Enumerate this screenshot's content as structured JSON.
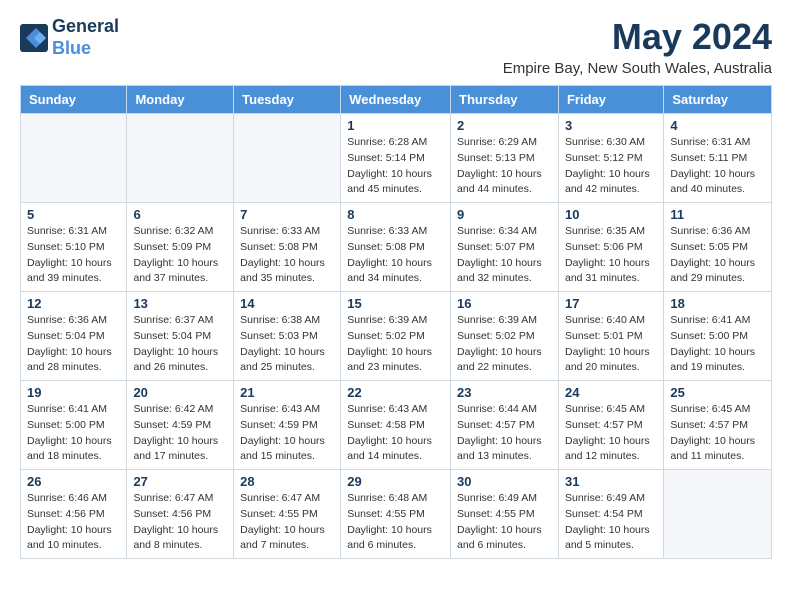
{
  "header": {
    "logo_line1": "General",
    "logo_line2": "Blue",
    "month_title": "May 2024",
    "location": "Empire Bay, New South Wales, Australia"
  },
  "weekdays": [
    "Sunday",
    "Monday",
    "Tuesday",
    "Wednesday",
    "Thursday",
    "Friday",
    "Saturday"
  ],
  "weeks": [
    [
      {
        "day": "",
        "info": ""
      },
      {
        "day": "",
        "info": ""
      },
      {
        "day": "",
        "info": ""
      },
      {
        "day": "1",
        "info": "Sunrise: 6:28 AM\nSunset: 5:14 PM\nDaylight: 10 hours\nand 45 minutes."
      },
      {
        "day": "2",
        "info": "Sunrise: 6:29 AM\nSunset: 5:13 PM\nDaylight: 10 hours\nand 44 minutes."
      },
      {
        "day": "3",
        "info": "Sunrise: 6:30 AM\nSunset: 5:12 PM\nDaylight: 10 hours\nand 42 minutes."
      },
      {
        "day": "4",
        "info": "Sunrise: 6:31 AM\nSunset: 5:11 PM\nDaylight: 10 hours\nand 40 minutes."
      }
    ],
    [
      {
        "day": "5",
        "info": "Sunrise: 6:31 AM\nSunset: 5:10 PM\nDaylight: 10 hours\nand 39 minutes."
      },
      {
        "day": "6",
        "info": "Sunrise: 6:32 AM\nSunset: 5:09 PM\nDaylight: 10 hours\nand 37 minutes."
      },
      {
        "day": "7",
        "info": "Sunrise: 6:33 AM\nSunset: 5:08 PM\nDaylight: 10 hours\nand 35 minutes."
      },
      {
        "day": "8",
        "info": "Sunrise: 6:33 AM\nSunset: 5:08 PM\nDaylight: 10 hours\nand 34 minutes."
      },
      {
        "day": "9",
        "info": "Sunrise: 6:34 AM\nSunset: 5:07 PM\nDaylight: 10 hours\nand 32 minutes."
      },
      {
        "day": "10",
        "info": "Sunrise: 6:35 AM\nSunset: 5:06 PM\nDaylight: 10 hours\nand 31 minutes."
      },
      {
        "day": "11",
        "info": "Sunrise: 6:36 AM\nSunset: 5:05 PM\nDaylight: 10 hours\nand 29 minutes."
      }
    ],
    [
      {
        "day": "12",
        "info": "Sunrise: 6:36 AM\nSunset: 5:04 PM\nDaylight: 10 hours\nand 28 minutes."
      },
      {
        "day": "13",
        "info": "Sunrise: 6:37 AM\nSunset: 5:04 PM\nDaylight: 10 hours\nand 26 minutes."
      },
      {
        "day": "14",
        "info": "Sunrise: 6:38 AM\nSunset: 5:03 PM\nDaylight: 10 hours\nand 25 minutes."
      },
      {
        "day": "15",
        "info": "Sunrise: 6:39 AM\nSunset: 5:02 PM\nDaylight: 10 hours\nand 23 minutes."
      },
      {
        "day": "16",
        "info": "Sunrise: 6:39 AM\nSunset: 5:02 PM\nDaylight: 10 hours\nand 22 minutes."
      },
      {
        "day": "17",
        "info": "Sunrise: 6:40 AM\nSunset: 5:01 PM\nDaylight: 10 hours\nand 20 minutes."
      },
      {
        "day": "18",
        "info": "Sunrise: 6:41 AM\nSunset: 5:00 PM\nDaylight: 10 hours\nand 19 minutes."
      }
    ],
    [
      {
        "day": "19",
        "info": "Sunrise: 6:41 AM\nSunset: 5:00 PM\nDaylight: 10 hours\nand 18 minutes."
      },
      {
        "day": "20",
        "info": "Sunrise: 6:42 AM\nSunset: 4:59 PM\nDaylight: 10 hours\nand 17 minutes."
      },
      {
        "day": "21",
        "info": "Sunrise: 6:43 AM\nSunset: 4:59 PM\nDaylight: 10 hours\nand 15 minutes."
      },
      {
        "day": "22",
        "info": "Sunrise: 6:43 AM\nSunset: 4:58 PM\nDaylight: 10 hours\nand 14 minutes."
      },
      {
        "day": "23",
        "info": "Sunrise: 6:44 AM\nSunset: 4:57 PM\nDaylight: 10 hours\nand 13 minutes."
      },
      {
        "day": "24",
        "info": "Sunrise: 6:45 AM\nSunset: 4:57 PM\nDaylight: 10 hours\nand 12 minutes."
      },
      {
        "day": "25",
        "info": "Sunrise: 6:45 AM\nSunset: 4:57 PM\nDaylight: 10 hours\nand 11 minutes."
      }
    ],
    [
      {
        "day": "26",
        "info": "Sunrise: 6:46 AM\nSunset: 4:56 PM\nDaylight: 10 hours\nand 10 minutes."
      },
      {
        "day": "27",
        "info": "Sunrise: 6:47 AM\nSunset: 4:56 PM\nDaylight: 10 hours\nand 8 minutes."
      },
      {
        "day": "28",
        "info": "Sunrise: 6:47 AM\nSunset: 4:55 PM\nDaylight: 10 hours\nand 7 minutes."
      },
      {
        "day": "29",
        "info": "Sunrise: 6:48 AM\nSunset: 4:55 PM\nDaylight: 10 hours\nand 6 minutes."
      },
      {
        "day": "30",
        "info": "Sunrise: 6:49 AM\nSunset: 4:55 PM\nDaylight: 10 hours\nand 6 minutes."
      },
      {
        "day": "31",
        "info": "Sunrise: 6:49 AM\nSunset: 4:54 PM\nDaylight: 10 hours\nand 5 minutes."
      },
      {
        "day": "",
        "info": ""
      }
    ]
  ]
}
